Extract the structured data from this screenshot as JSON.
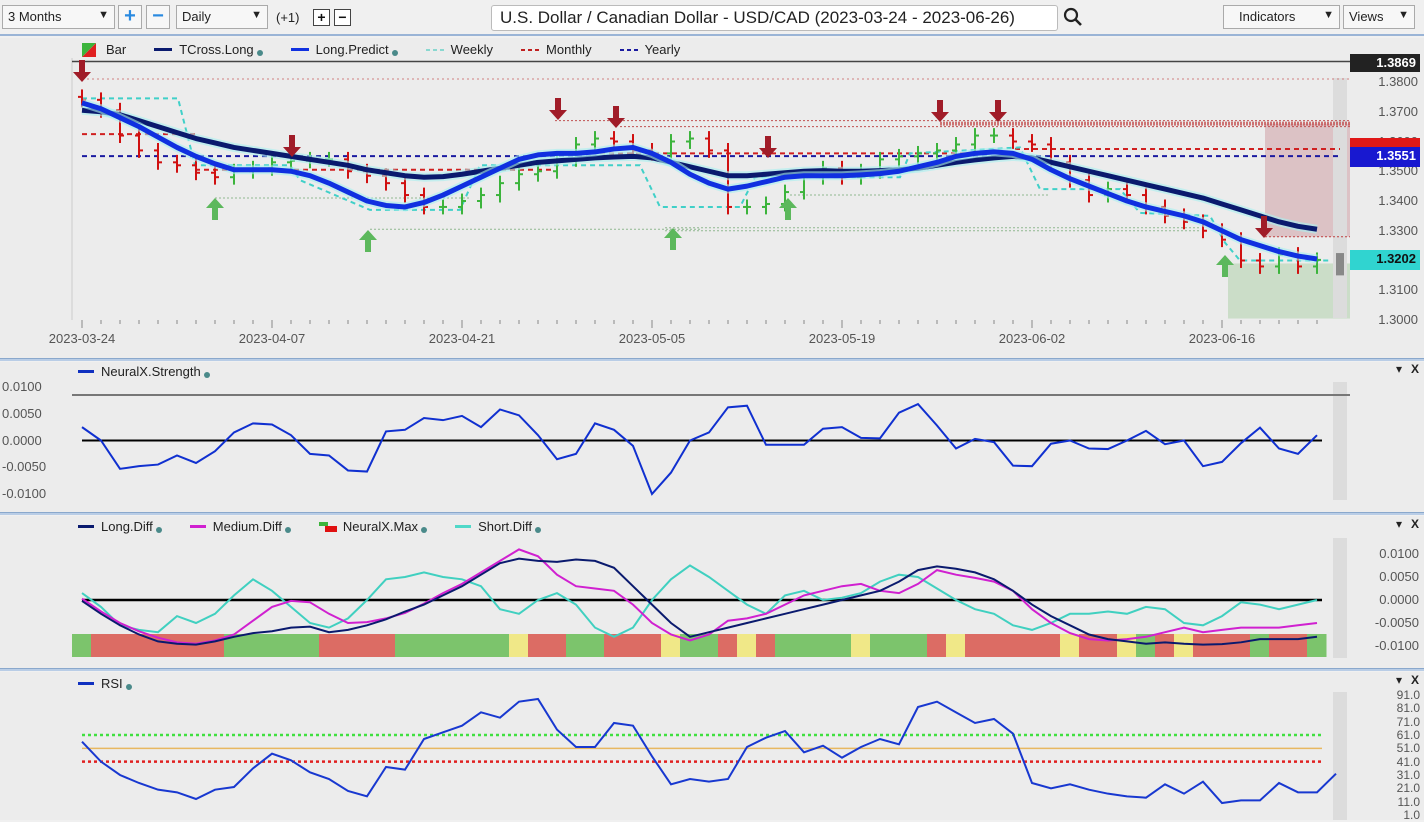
{
  "toolbar": {
    "range_value": "3 Months",
    "zoom_in_label": "+",
    "zoom_out_label": "−",
    "interval_value": "Daily",
    "offset_label": "(+1)",
    "add_label": "+",
    "remove_label": "−",
    "title": "U.S. Dollar / Canadian Dollar - USD/CAD (2023-03-24 - 2023-06-26)",
    "search_icon": "search-icon",
    "indicators_label": "Indicators",
    "views_label": "Views"
  },
  "colors": {
    "bull": "#3cb43c",
    "bear": "#d01010",
    "tcross_long": "#0a1a6e",
    "long_predict": "#1030e0",
    "weekly": "#40d0c8",
    "monthly": "#d02020",
    "yearly": "#1a1aa0",
    "arrow_down": "#a01c28",
    "arrow_up": "#5cb85c"
  },
  "chart_data": [
    {
      "type": "line",
      "title": "U.S. Dollar / Canadian Dollar - USD/CAD (2023-03-24 - 2023-06-26)",
      "legend": [
        "Bar",
        "TCross.Long",
        "Long.Predict",
        "Weekly",
        "Monthly",
        "Yearly"
      ],
      "x_tick_labels": [
        "2023-03-24",
        "2023-04-07",
        "2023-04-21",
        "2023-05-05",
        "2023-05-19",
        "2023-06-02",
        "2023-06-16"
      ],
      "y_tick_labels": [
        "1.3800",
        "1.3700",
        "1.3600",
        "1.3500",
        "1.3400",
        "1.3300",
        "1.3200",
        "1.3100",
        "1.3000"
      ],
      "ylim": [
        1.2985,
        1.3885
      ],
      "price_tags": {
        "high": "1.3869",
        "yearly": "1.3551",
        "last": "1.3202"
      },
      "bars_close": [
        1.374,
        1.3705,
        1.362,
        1.357,
        1.353,
        1.352,
        1.3495,
        1.348,
        1.35,
        1.351,
        1.353,
        1.3535,
        1.354,
        1.354,
        1.35,
        1.3485,
        1.346,
        1.342,
        1.338,
        1.338,
        1.34,
        1.342,
        1.346,
        1.349,
        1.35,
        1.354,
        1.359,
        1.361,
        1.36,
        1.357,
        1.356,
        1.36,
        1.361,
        1.357,
        1.338,
        1.338,
        1.339,
        1.343,
        1.348,
        1.351,
        1.348,
        1.35,
        1.354,
        1.355,
        1.356,
        1.357,
        1.359,
        1.362,
        1.362,
        1.36,
        1.359,
        1.353,
        1.347,
        1.342,
        1.344,
        1.342,
        1.338,
        1.335,
        1.333,
        1.33,
        1.327,
        1.32,
        1.318,
        1.322,
        1.318,
        1.3202
      ],
      "series": [
        {
          "name": "TCross.Long",
          "values": [
            1.3705,
            1.37,
            1.369,
            1.367,
            1.365,
            1.363,
            1.361,
            1.3595,
            1.358,
            1.357,
            1.356,
            1.355,
            1.354,
            1.353,
            1.352,
            1.3505,
            1.3495,
            1.3485,
            1.348,
            1.3482,
            1.349,
            1.35,
            1.351,
            1.352,
            1.353,
            1.3535,
            1.354,
            1.3545,
            1.3548,
            1.355,
            1.3545,
            1.353,
            1.3515,
            1.35,
            1.3485,
            1.3485,
            1.349,
            1.3495,
            1.35,
            1.3502,
            1.35,
            1.35,
            1.3502,
            1.3505,
            1.351,
            1.352,
            1.353,
            1.3538,
            1.3545,
            1.355,
            1.3545,
            1.353,
            1.3515,
            1.35,
            1.3485,
            1.347,
            1.3455,
            1.344,
            1.3425,
            1.341,
            1.339,
            1.337,
            1.335,
            1.333,
            1.3315,
            1.3305
          ]
        },
        {
          "name": "Long.Predict",
          "values": [
            1.373,
            1.371,
            1.368,
            1.365,
            1.3615,
            1.358,
            1.355,
            1.3525,
            1.3505,
            1.3505,
            1.3505,
            1.35,
            1.3485,
            1.346,
            1.343,
            1.34,
            1.3385,
            1.338,
            1.3395,
            1.342,
            1.345,
            1.348,
            1.351,
            1.354,
            1.3555,
            1.356,
            1.356,
            1.3565,
            1.3575,
            1.358,
            1.356,
            1.353,
            1.349,
            1.346,
            1.344,
            1.345,
            1.3465,
            1.348,
            1.3485,
            1.3485,
            1.3485,
            1.3488,
            1.3492,
            1.35,
            1.3515,
            1.353,
            1.355,
            1.356,
            1.3565,
            1.356,
            1.354,
            1.3505,
            1.3475,
            1.345,
            1.3425,
            1.34,
            1.338,
            1.3365,
            1.335,
            1.333,
            1.33,
            1.327,
            1.325,
            1.323,
            1.3215,
            1.3205
          ]
        }
      ],
      "levels": {
        "weekly_high": 1.3745,
        "monthly": 1.362,
        "yearly": 1.3551
      }
    },
    {
      "type": "line",
      "title": "NeuralX.Strength",
      "legend": [
        "NeuralX.Strength"
      ],
      "y_tick_labels": [
        "0.0100",
        "0.0050",
        "0.0000",
        "-0.0050",
        "-0.0100"
      ],
      "ylim": [
        -0.0115,
        0.0115
      ],
      "series": [
        {
          "name": "NeuralX.Strength",
          "values": [
            0.0025,
            0.0,
            -0.0053,
            -0.0048,
            -0.0045,
            -0.0028,
            -0.0042,
            -0.002,
            0.0015,
            0.0032,
            0.003,
            0.001,
            -0.0025,
            -0.0028,
            -0.0056,
            -0.0058,
            0.0017,
            0.002,
            0.0042,
            0.0038,
            0.0046,
            0.0025,
            0.0058,
            0.0047,
            0.001,
            -0.0035,
            -0.0025,
            0.0032,
            0.002,
            -0.001,
            -0.01,
            -0.006,
            0.0,
            0.0015,
            0.0062,
            0.0065,
            -0.0008,
            -0.0008,
            -0.0008,
            0.0022,
            0.0025,
            0.0005,
            0.0004,
            0.0052,
            0.0068,
            0.0028,
            -0.0015,
            0.0003,
            -0.0003,
            -0.0047,
            -0.0048,
            -0.0006,
            0.0,
            -0.0015,
            -0.0016,
            0.0,
            0.0018,
            -0.0007,
            0.0,
            -0.0048,
            -0.004,
            -0.0005,
            0.0024,
            -0.0015,
            -0.0025,
            0.001
          ]
        }
      ],
      "reference_lines": [
        0.0,
        0.0085
      ]
    },
    {
      "type": "line",
      "title": "Long.Diff / Medium.Diff / NeuralX.Max / Short.Diff",
      "legend": [
        "Long.Diff",
        "Medium.Diff",
        "NeuralX.Max",
        "Short.Diff"
      ],
      "y_tick_labels": [
        "0.0100",
        "0.0050",
        "0.0000",
        "-0.0050",
        "-0.0100"
      ],
      "ylim": [
        -0.0125,
        0.0125
      ],
      "series": [
        {
          "name": "Long.Diff",
          "values": [
            -0.0002,
            -0.003,
            -0.0055,
            -0.0075,
            -0.009,
            -0.0095,
            -0.0097,
            -0.009,
            -0.008,
            -0.0072,
            -0.0068,
            -0.006,
            -0.0058,
            -0.007,
            -0.0065,
            -0.0055,
            -0.0042,
            -0.0025,
            -0.001,
            0.001,
            0.003,
            0.0055,
            0.008,
            0.009,
            0.0085,
            0.0083,
            0.0088,
            0.0085,
            0.007,
            0.003,
            -0.001,
            -0.005,
            -0.008,
            -0.007,
            -0.006,
            -0.005,
            -0.004,
            -0.003,
            -0.002,
            -0.001,
            0.0,
            0.001,
            0.002,
            0.004,
            0.0065,
            0.0073,
            0.0068,
            0.006,
            0.0045,
            0.002,
            -0.001,
            -0.0035,
            -0.0055,
            -0.0075,
            -0.0085,
            -0.009,
            -0.0095,
            -0.0092,
            -0.0095,
            -0.0097,
            -0.0096,
            -0.0092,
            -0.0085,
            -0.0085,
            -0.0085,
            -0.008
          ]
        },
        {
          "name": "Medium.Diff",
          "values": [
            0.0003,
            -0.0025,
            -0.005,
            -0.0068,
            -0.0082,
            -0.0092,
            -0.0095,
            -0.0088,
            -0.0075,
            -0.0045,
            -0.0015,
            -0.0002,
            -0.0005,
            -0.003,
            -0.005,
            -0.0048,
            -0.004,
            -0.0028,
            -0.0008,
            0.0015,
            0.0035,
            0.006,
            0.0085,
            0.011,
            0.0095,
            0.0055,
            0.003,
            0.0025,
            0.002,
            -0.001,
            -0.005,
            -0.0075,
            -0.0088,
            -0.0075,
            -0.0045,
            -0.004,
            -0.003,
            -0.001,
            0.001,
            0.002,
            0.003,
            0.0035,
            0.002,
            0.0015,
            0.0035,
            0.0065,
            0.0055,
            0.0048,
            0.004,
            0.002,
            -0.002,
            -0.005,
            -0.0072,
            -0.0085,
            -0.0088,
            -0.0085,
            -0.008,
            -0.007,
            -0.006,
            -0.007,
            -0.0065,
            -0.006,
            -0.006,
            -0.006,
            -0.0055,
            -0.005
          ]
        },
        {
          "name": "Short.Diff",
          "values": [
            0.0015,
            -0.0015,
            -0.0055,
            -0.0065,
            -0.007,
            -0.0035,
            -0.005,
            -0.003,
            0.001,
            0.0045,
            0.002,
            -0.0015,
            -0.005,
            -0.006,
            -0.004,
            0.0,
            0.0045,
            0.005,
            0.006,
            0.005,
            0.0045,
            0.003,
            -0.002,
            -0.003,
            0.0,
            0.0015,
            -0.001,
            -0.006,
            -0.008,
            -0.006,
            0.0,
            0.0045,
            0.0075,
            0.005,
            0.002,
            -0.001,
            -0.003,
            0.001,
            0.002,
            0.0,
            0.0005,
            0.0015,
            0.004,
            0.0055,
            0.005,
            0.0025,
            0.0,
            -0.002,
            -0.003,
            -0.0055,
            -0.0065,
            -0.005,
            -0.003,
            -0.003,
            -0.0025,
            -0.003,
            -0.0015,
            -0.002,
            -0.005,
            -0.0055,
            -0.0035,
            -0.0005,
            -0.001,
            -0.002,
            -0.001,
            0.0
          ]
        }
      ],
      "neuralx_max_segments": [
        "green",
        "red",
        "red",
        "red",
        "red",
        "red",
        "red",
        "red",
        "green",
        "green",
        "green",
        "green",
        "green",
        "red",
        "red",
        "red",
        "red",
        "green",
        "green",
        "green",
        "green",
        "green",
        "green",
        "yellow",
        "red",
        "red",
        "green",
        "green",
        "red",
        "red",
        "red",
        "yellow",
        "green",
        "green",
        "red",
        "yellow",
        "red",
        "green",
        "green",
        "green",
        "green",
        "yellow",
        "green",
        "green",
        "green",
        "red",
        "yellow",
        "red",
        "red",
        "red",
        "red",
        "red",
        "yellow",
        "red",
        "red",
        "yellow",
        "green",
        "red",
        "yellow",
        "red",
        "red",
        "red",
        "green",
        "red",
        "red",
        "green"
      ]
    },
    {
      "type": "line",
      "title": "RSI",
      "legend": [
        "RSI"
      ],
      "y_tick_labels": [
        "91.0",
        "81.0",
        "71.0",
        "61.0",
        "51.0",
        "41.0",
        "31.0",
        "21.0",
        "11.0",
        "1.0"
      ],
      "ylim": [
        1,
        91
      ],
      "series": [
        {
          "name": "RSI",
          "values": [
            56,
            41,
            31,
            25,
            20,
            18,
            13,
            20,
            22,
            36,
            47,
            42,
            33,
            28,
            19,
            15,
            37,
            35,
            58,
            63,
            68,
            78,
            74,
            86,
            88,
            65,
            52,
            52,
            70,
            68,
            45,
            24,
            28,
            26,
            28,
            52,
            59,
            64,
            48,
            53,
            44,
            52,
            58,
            54,
            82,
            86,
            78,
            70,
            73,
            62,
            25,
            21,
            24,
            20,
            17,
            15,
            14,
            24,
            17,
            26,
            10,
            12,
            12,
            25,
            18,
            18,
            32
          ]
        }
      ],
      "reference_lines": {
        "overbought": 61,
        "mid": 51,
        "oversold": 41
      }
    }
  ],
  "x_ticks": [
    "2023-03-24",
    "2023-04-07",
    "2023-04-21",
    "2023-05-05",
    "2023-05-19",
    "2023-06-02",
    "2023-06-16"
  ],
  "panels": {
    "main_legend": [
      "Bar",
      "TCross.Long",
      "Long.Predict",
      "Weekly",
      "Monthly",
      "Yearly"
    ],
    "strength_legend": "NeuralX.Strength",
    "diff_legend": [
      "Long.Diff",
      "Medium.Diff",
      "NeuralX.Max",
      "Short.Diff"
    ],
    "rsi_legend": "RSI",
    "collapse_icon": "▾",
    "close_icon": "X"
  }
}
